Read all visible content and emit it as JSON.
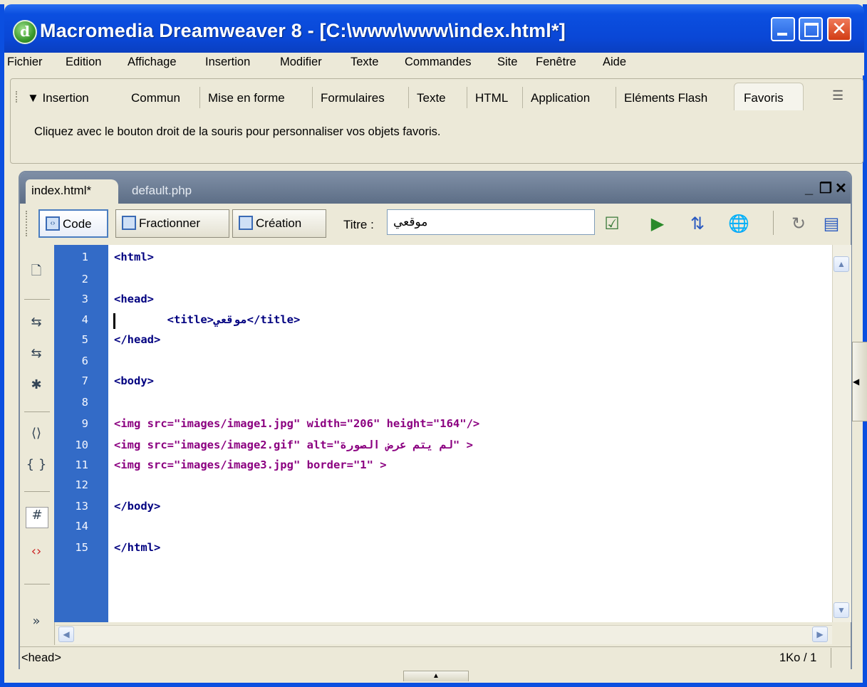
{
  "window": {
    "title": "Macromedia Dreamweaver 8 - [C:\\www\\www\\index.html*]",
    "app_icon_glyph": "d"
  },
  "menu": [
    "Fichier",
    "Edition",
    "Affichage",
    "Insertion",
    "Modifier",
    "Texte",
    "Commandes",
    "Site",
    "Fenêtre",
    "Aide"
  ],
  "insert_bar": {
    "label": "▼ Insertion",
    "tabs": [
      "Commun",
      "Mise en forme",
      "Formulaires",
      "Texte",
      "HTML",
      "Application",
      "Eléments Flash",
      "Favoris"
    ],
    "active_tab": "Favoris",
    "hint": "Cliquez avec le bouton droit de la souris pour personnaliser vos objets favoris."
  },
  "document": {
    "tabs": [
      "index.html*",
      "default.php"
    ],
    "active_tab": "index.html*",
    "views": {
      "code": "Code",
      "split": "Fractionner",
      "design": "Création"
    },
    "title_label": "Titre :",
    "title_value": "موقعي"
  },
  "code_lines": [
    {
      "n": "1",
      "text": "<html>"
    },
    {
      "n": "2",
      "text": ""
    },
    {
      "n": "3",
      "text": "<head>"
    },
    {
      "n": "4",
      "text": "        <title>موقعي</title>"
    },
    {
      "n": "5",
      "text": "</head>"
    },
    {
      "n": "6",
      "text": ""
    },
    {
      "n": "7",
      "text": "<body>"
    },
    {
      "n": "8",
      "text": ""
    },
    {
      "n": "9",
      "text": "<img src=\"images/image1.jpg\" width=\"206\" height=\"164\"/>"
    },
    {
      "n": "10",
      "text": "<img src=\"images/image2.gif\" alt=\"لم يتم عرض الصورة\" >"
    },
    {
      "n": "11",
      "text": "<img src=\"images/image3.jpg\" border=\"1\" >"
    },
    {
      "n": "12",
      "text": ""
    },
    {
      "n": "13",
      "text": "</body>"
    },
    {
      "n": "14",
      "text": ""
    },
    {
      "n": "15",
      "text": "</html>"
    }
  ],
  "status": {
    "tag": "<head>",
    "size": "1Ko / 1"
  },
  "colors": {
    "titlebar": "#0b4fe0",
    "gutter": "#336bc7",
    "tag_color": "#000080",
    "attr_color": "#8b0080"
  }
}
